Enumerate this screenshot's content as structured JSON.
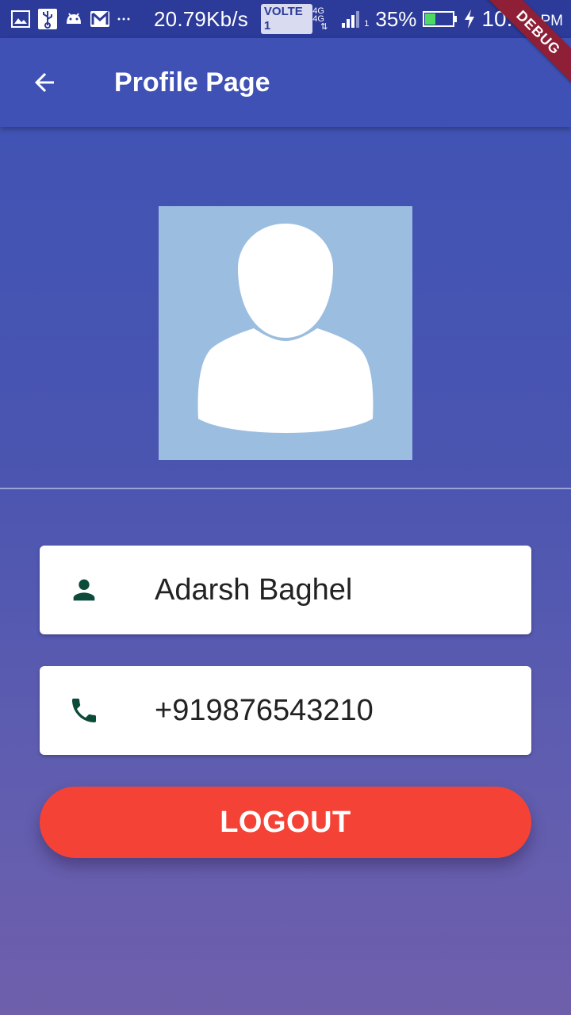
{
  "status_bar": {
    "net_speed": "20.79Kb/s",
    "volte": "VOLTE 1",
    "net_type_top": "4G 4G",
    "sim_index": "1",
    "battery_percent": "35%",
    "time": "10:46",
    "ampm": "PM"
  },
  "debug_banner": "DEBUG",
  "app_bar": {
    "title": "Profile Page"
  },
  "profile": {
    "name": "Adarsh Baghel",
    "phone": "+919876543210"
  },
  "logout_label": "LOGOUT",
  "colors": {
    "primary": "#3f51b5",
    "status_bar": "#2c3a99",
    "logout": "#f44336",
    "icon_green": "#0c4a3a",
    "avatar_bg": "#9bbde0"
  }
}
